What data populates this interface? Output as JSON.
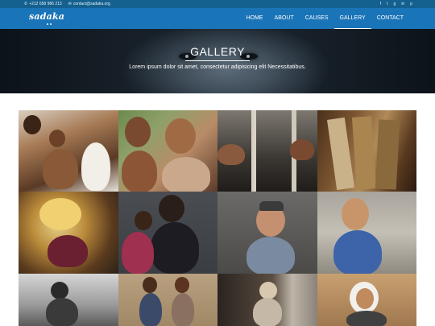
{
  "topbar": {
    "phone": "+212 658 986 213",
    "email": "contact@sadaka.org",
    "social_icons": [
      "facebook-icon",
      "twitter-icon",
      "google-plus-icon",
      "linkedin-icon",
      "pinterest-icon"
    ]
  },
  "header": {
    "logo": "sadaka",
    "nav": [
      "HOME",
      "ABOUT",
      "CAUSES",
      "GALLERY",
      "CONTACT"
    ],
    "active": "GALLERY"
  },
  "hero": {
    "title": "GALLERY",
    "subtitle": "Lorem ipsum dolor sit amet, consectetur adipisicing elit Necessitatibus."
  },
  "colors": {
    "topbar": "#14608f",
    "navbar": "#1a74b8",
    "page_background": "#ffffff"
  },
  "gallery": {
    "photos": [
      "children-medical-care-photo",
      "two-smiling-girls-photo",
      "hands-holding-sticks-photo",
      "old-books-stack-photo",
      "hands-holding-fruit-photo",
      "girl-at-blackboard-photo",
      "boy-with-cap-photo",
      "smiling-boy-rocks-photo",
      "boy-black-white-photo",
      "two-children-wall-photo",
      "child-on-bed-photo",
      "girl-headscarf-photo"
    ]
  }
}
